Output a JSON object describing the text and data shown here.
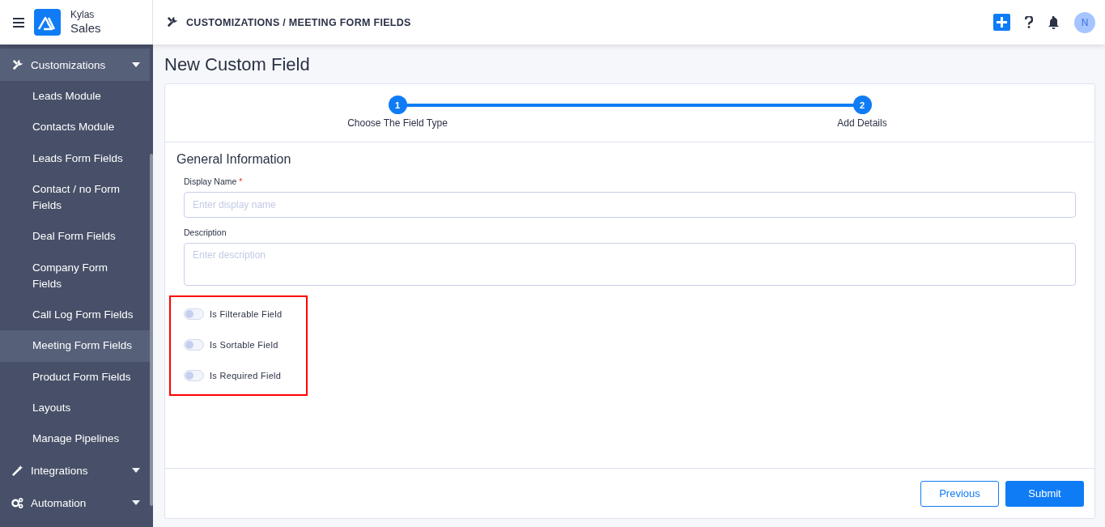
{
  "brand": {
    "small": "Kylas",
    "large": "Sales"
  },
  "breadcrumb": "CUSTOMIZATIONS / MEETING FORM FIELDS",
  "header_actions": {
    "avatar": "N"
  },
  "sidebar": {
    "groups": [
      {
        "label": "Customizations",
        "expanded": true,
        "children": [
          {
            "label": "Leads Module",
            "selected": false
          },
          {
            "label": "Contacts Module",
            "selected": false
          },
          {
            "label": "Leads Form Fields",
            "selected": false
          },
          {
            "label": "Contact / no Form Fields",
            "selected": false
          },
          {
            "label": "Deal Form Fields",
            "selected": false
          },
          {
            "label": "Company Form Fields",
            "selected": false
          },
          {
            "label": "Call Log Form Fields",
            "selected": false
          },
          {
            "label": "Meeting Form Fields",
            "selected": true
          },
          {
            "label": "Product Form Fields",
            "selected": false
          },
          {
            "label": "Layouts",
            "selected": false
          },
          {
            "label": "Manage Pipelines",
            "selected": false
          }
        ]
      },
      {
        "label": "Integrations",
        "expanded": false
      },
      {
        "label": "Automation",
        "expanded": false
      }
    ]
  },
  "page_title": "New Custom Field",
  "steps": [
    {
      "number": "1",
      "label": "Choose The Field Type"
    },
    {
      "number": "2",
      "label": "Add Details"
    }
  ],
  "section_title": "General Information",
  "fields": [
    {
      "label": "Display Name",
      "required_mark": "*",
      "placeholder": "Enter display name",
      "kind": "input"
    },
    {
      "label": "Description",
      "placeholder": "Enter description",
      "kind": "textarea"
    }
  ],
  "toggles": [
    {
      "label": "Is Filterable Field",
      "on": false
    },
    {
      "label": "Is Sortable Field",
      "on": false
    },
    {
      "label": "Is Required Field",
      "on": false
    }
  ],
  "buttons": {
    "previous": "Previous",
    "submit": "Submit"
  }
}
